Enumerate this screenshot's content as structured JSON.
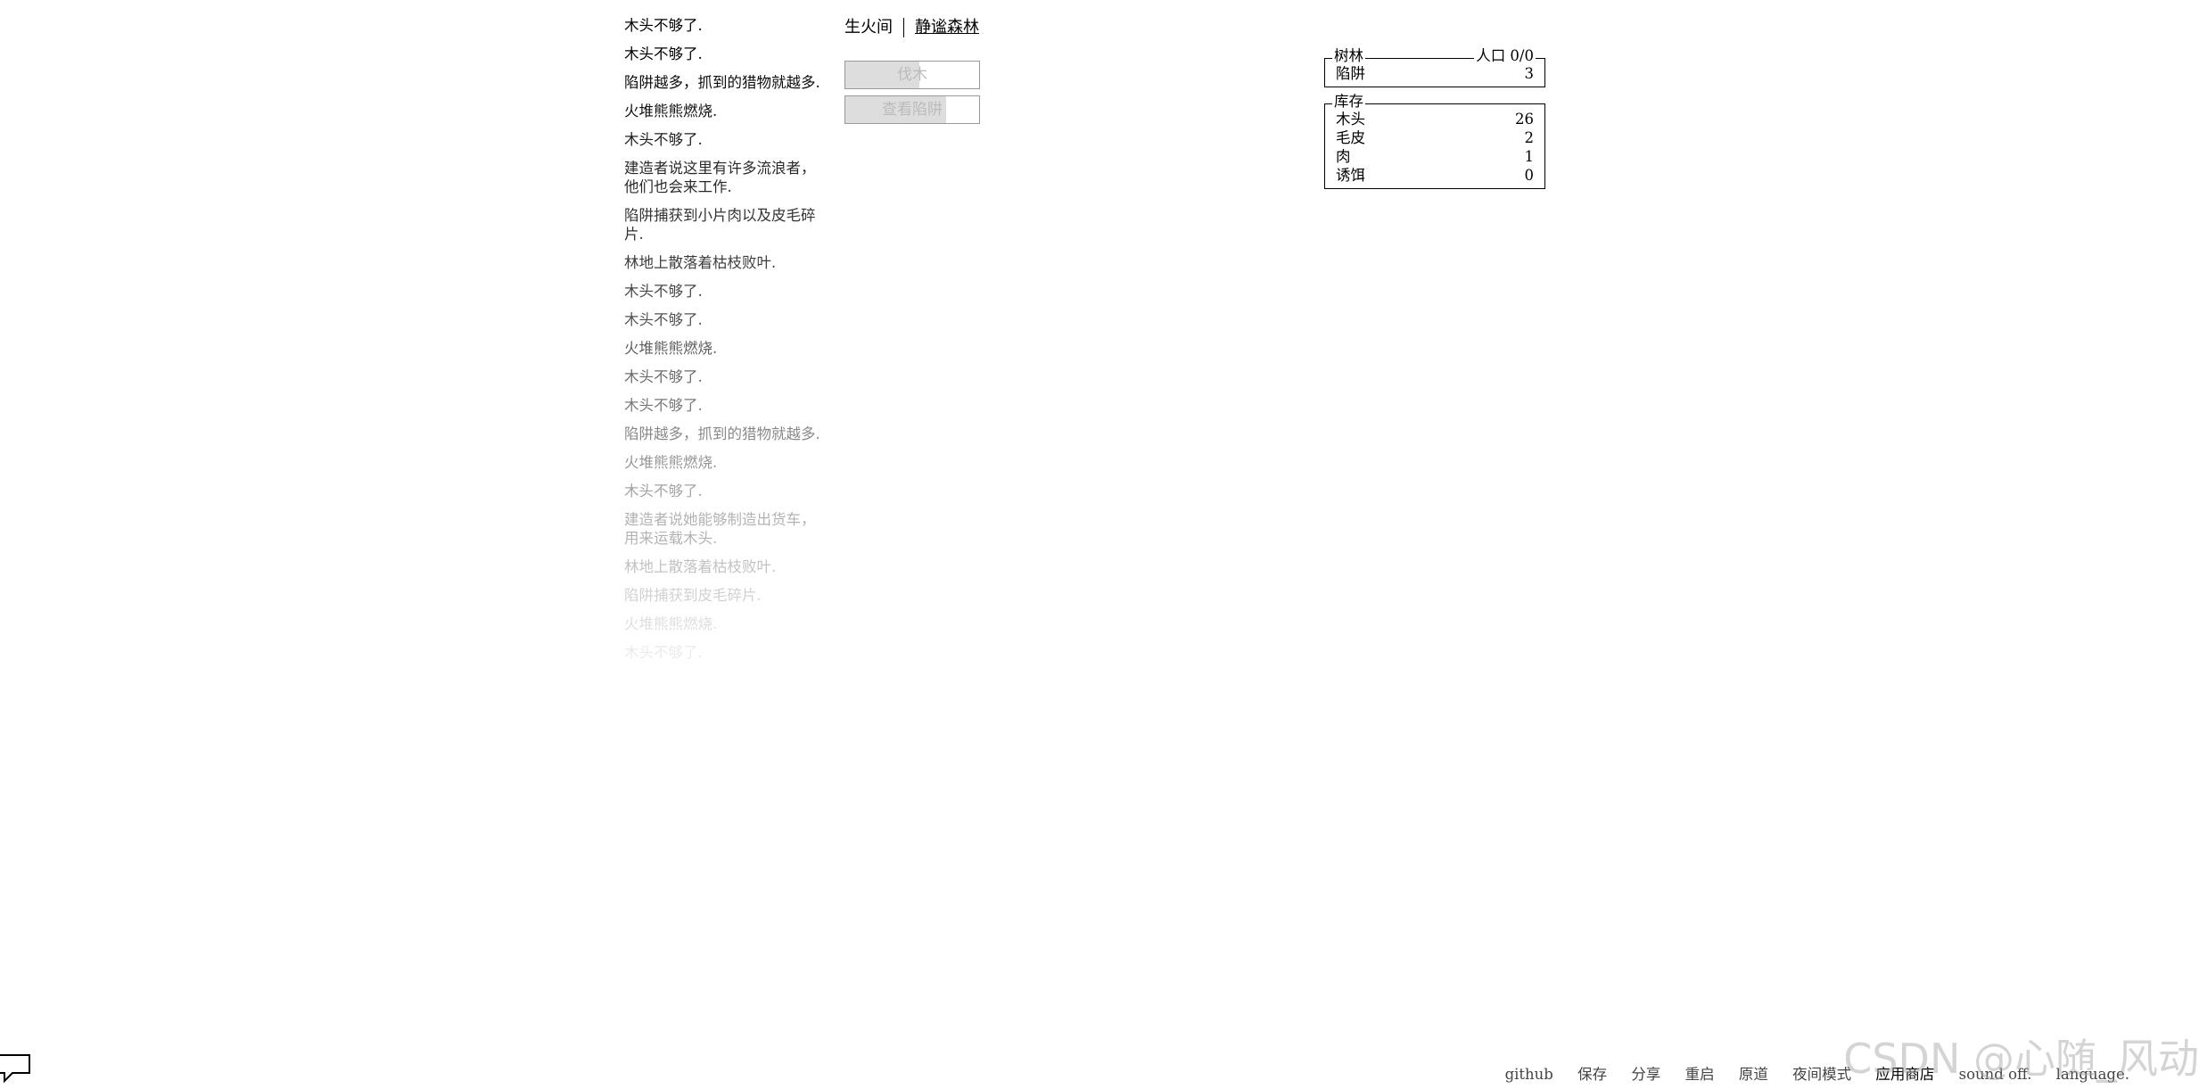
{
  "notifications": [
    {
      "text": "木头不够了.",
      "opacity": 1
    },
    {
      "text": "木头不够了.",
      "opacity": 1
    },
    {
      "text": "陷阱越多，抓到的猎物就越多.",
      "opacity": 0.95
    },
    {
      "text": "火堆熊熊燃烧.",
      "opacity": 0.92
    },
    {
      "text": "木头不够了.",
      "opacity": 0.88
    },
    {
      "text": "建造者说这里有许多流浪者，他们也会来工作.",
      "opacity": 0.84
    },
    {
      "text": "陷阱捕获到小片肉以及皮毛碎片.",
      "opacity": 0.8
    },
    {
      "text": "林地上散落着枯枝败叶.",
      "opacity": 0.76
    },
    {
      "text": "木头不够了.",
      "opacity": 0.72
    },
    {
      "text": "木头不够了.",
      "opacity": 0.68
    },
    {
      "text": "火堆熊熊燃烧.",
      "opacity": 0.63
    },
    {
      "text": "木头不够了.",
      "opacity": 0.58
    },
    {
      "text": "木头不够了.",
      "opacity": 0.53
    },
    {
      "text": "陷阱越多，抓到的猎物就越多.",
      "opacity": 0.47
    },
    {
      "text": "火堆熊熊燃烧.",
      "opacity": 0.41
    },
    {
      "text": "木头不够了.",
      "opacity": 0.36
    },
    {
      "text": "建造者说她能够制造出货车，用来运载木头.",
      "opacity": 0.3
    },
    {
      "text": "林地上散落着枯枝败叶.",
      "opacity": 0.24
    },
    {
      "text": "陷阱捕获到皮毛碎片.",
      "opacity": 0.18
    },
    {
      "text": "火堆熊熊燃烧.",
      "opacity": 0.13
    },
    {
      "text": "木头不够了.",
      "opacity": 0.08
    }
  ],
  "header": {
    "tab_room": "生火间",
    "tab_forest": "静谧森林"
  },
  "buttons": {
    "gather_wood": "伐木",
    "gather_wood_cooldown": 0.55,
    "check_traps": "查看陷阱",
    "check_traps_cooldown": 0.75
  },
  "buildings": {
    "title": "树林",
    "population_label": "人口 0/0",
    "items": [
      {
        "name": "陷阱",
        "count": "3"
      }
    ]
  },
  "stores": {
    "title": "库存",
    "items": [
      {
        "name": "木头",
        "count": "26"
      },
      {
        "name": "毛皮",
        "count": "2"
      },
      {
        "name": "肉",
        "count": "1"
      },
      {
        "name": "诱饵",
        "count": "0"
      }
    ]
  },
  "menu": {
    "github": "github",
    "save": "保存",
    "share": "分享",
    "restart": "重启",
    "original": "原道",
    "night_mode": "夜间模式",
    "app_store": "应用商店",
    "sound": "sound off.",
    "language": "language."
  },
  "watermark": "CSDN @心随_风动",
  "icons": {
    "chat": "chat-bubble-icon"
  }
}
